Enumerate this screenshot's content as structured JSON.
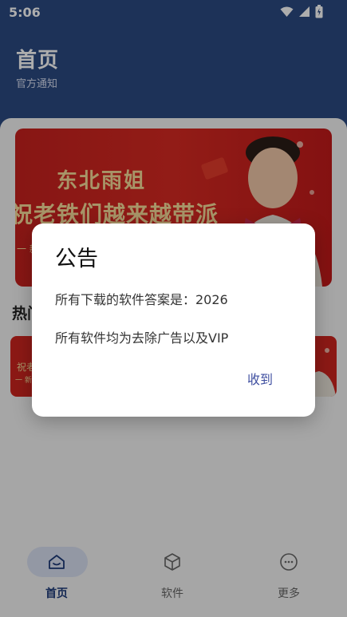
{
  "status": {
    "time": "5:06"
  },
  "header": {
    "title": "首页",
    "subtitle": "官方通知"
  },
  "banner": {
    "title_line1": "东北雨姐",
    "title_line2": "祝老铁们越来越带派",
    "footer_text": "一 新"
  },
  "section": {
    "title": "热门"
  },
  "cards": {
    "left_text1": "祝老",
    "left_text2": "一 新"
  },
  "dialog": {
    "title": "公告",
    "line1": "所有下载的软件答案是：2026",
    "line2": "所有软件均为去除广告以及VIP",
    "confirm_label": "收到"
  },
  "nav": {
    "items": [
      {
        "label": "首页",
        "icon": "home-icon",
        "active": true
      },
      {
        "label": "软件",
        "icon": "cube-icon",
        "active": false
      },
      {
        "label": "更多",
        "icon": "more-icon",
        "active": false
      }
    ]
  },
  "colors": {
    "header_bg": "#2b4a82",
    "accent": "#1d3a7a",
    "banner_red": "#d82a22",
    "dialog_button": "#3f4fa0"
  }
}
